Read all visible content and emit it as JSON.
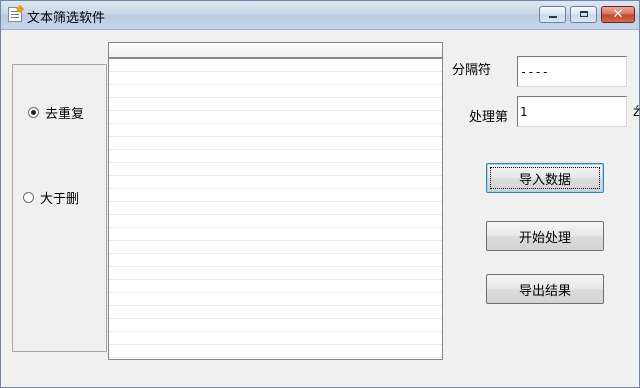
{
  "window": {
    "title": "文本筛选软件",
    "controls": {
      "minimize": "▁",
      "maximize": "□",
      "close": "✕"
    }
  },
  "mode_group": {
    "options": [
      {
        "label": "去重复",
        "checked": true
      },
      {
        "label": "大于删",
        "checked": false
      }
    ]
  },
  "list": {
    "rows": []
  },
  "settings": {
    "separator_label": "分隔符",
    "separator_value": "----",
    "column_label": "处理第",
    "column_value": "1",
    "column_suffix": "ź"
  },
  "buttons": {
    "import_label": "导入数据",
    "start_label": "开始处理",
    "export_label": "导出结果"
  },
  "icons": [
    "app-icon",
    "minimize-icon",
    "maximize-icon",
    "close-icon"
  ]
}
